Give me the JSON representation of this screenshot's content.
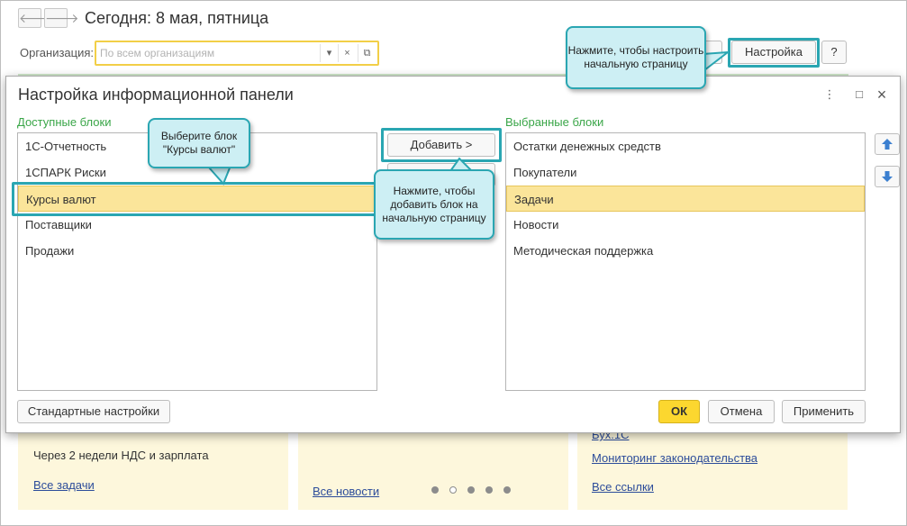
{
  "header": {
    "back_icon": "arrow-left-icon",
    "forward_icon": "arrow-right-icon",
    "back_glyph": "🡐",
    "forward_glyph": "🡒",
    "title": "Сегодня: 8 мая, пятница"
  },
  "org": {
    "label": "Организация:",
    "placeholder": "По всем организациям",
    "dropdown_glyph": "▾",
    "clear_glyph": "×",
    "open_glyph": "⧉"
  },
  "toolbar": {
    "setup_label": "Настройка",
    "help_label": "?"
  },
  "dialog": {
    "title": "Настройка информационной панели",
    "more_glyph": "⋮",
    "maximize_glyph": "□",
    "close_glyph": "×",
    "available_label": "Доступные блоки",
    "selected_label": "Выбранные блоки",
    "available_items": [
      "1С-Отчетность",
      "1СПАРК Риски",
      "Курсы валют",
      "Поставщики",
      "Продажи"
    ],
    "selected_items": [
      "Остатки денежных средств",
      "Покупатели",
      "Задачи",
      "Новости",
      "Методическая поддержка"
    ],
    "add_label": "Добавить >",
    "default_label": "Стандартные настройки",
    "ok_label": "ОК",
    "cancel_label": "Отмена",
    "apply_label": "Применить"
  },
  "background": {
    "left_card_text": "Через 2 недели НДС и зарплата",
    "left_card_link": "Все задачи",
    "mid_card_link": "Все новости",
    "right_card_top": "Бух.1С",
    "right_card_link1": "Мониторинг законодательства",
    "right_card_link2": "Все ссылки"
  },
  "callouts": {
    "setup_hint": "Нажмите, чтобы настроить начальную страницу",
    "select_hint": "Выберите блок \"Курсы валют\"",
    "add_hint": "Нажмите, чтобы добавить блок на начальную страницу"
  },
  "colors": {
    "highlight": "#2aa6b2",
    "callout_bg": "#cdeff4",
    "selection": "#fbe59a",
    "ok_button": "#fcd72f",
    "green_label": "#3aa648"
  }
}
